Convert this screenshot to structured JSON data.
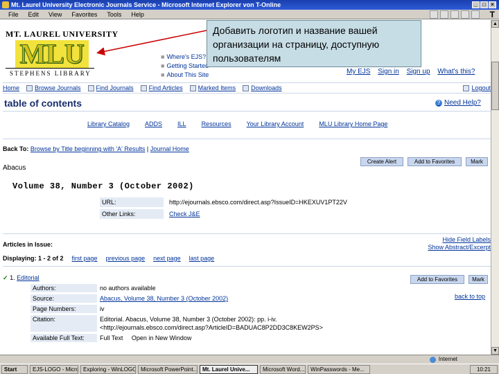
{
  "window": {
    "title": "Mt. Laurel University Electronic Journals Service - Microsoft Internet Explorer von T-Online",
    "menu": [
      "File",
      "Edit",
      "View",
      "Favorites",
      "Tools",
      "Help"
    ],
    "brand": "T"
  },
  "logo": {
    "top": "MT. LAUREL UNIVERSITY",
    "mark": "MLU",
    "bottom": "STEPHENS LIBRARY"
  },
  "top_links": [
    "Where's EJS?",
    "Getting Started",
    "About This Site"
  ],
  "callout": {
    "text": "Добавить логотип и название вашей организации на страницу, доступную пользователям"
  },
  "user_links": [
    "My EJS",
    "Sign in",
    "Sign up",
    "What's this?"
  ],
  "nav": {
    "items": [
      "Home",
      "Browse Journals",
      "Find Journals",
      "Find Articles",
      "Marked Items",
      "Downloads"
    ],
    "logout": "Logout"
  },
  "page": {
    "title": "table of contents",
    "help": "Need Help?"
  },
  "library_links": [
    "Library Catalog",
    "ADDS",
    "ILL",
    "Resources",
    "Your Library Account",
    "MLU Library Home Page"
  ],
  "back": {
    "label": "Back To:",
    "link1": "Browse by Title beginning with 'A' Results",
    "sep": "|",
    "link2": "Journal Home"
  },
  "buttons": {
    "create_alert": "Create Alert",
    "add_favorites": "Add to Favorites",
    "mark": "Mark",
    "item_add_favorites": "Add to Favorites",
    "item_mark": "Mark"
  },
  "journal": {
    "name": "Abacus",
    "volume": "Volume 38, Number 3 (October 2002)",
    "url_label": "URL:",
    "url": "http://ejournals.ebsco.com/direct.asp?IssueID=HKEXUV1PT22V",
    "other_label": "Other Links:",
    "other_value": "Check J&E"
  },
  "articles": {
    "heading": "Articles in Issue:",
    "side_links": [
      "Hide Field Labels",
      "Show Abstract/Excerpt"
    ],
    "displaying": "Displaying: 1 - 2 of 2",
    "paging": [
      "first page",
      "previous page",
      "next page",
      "last page"
    ]
  },
  "item": {
    "check": "✓",
    "number": "1.",
    "title": "Editorial",
    "back_to_top": "back to top",
    "fields": [
      {
        "label": "Authors:",
        "value": "no authors available",
        "link": false
      },
      {
        "label": "Source:",
        "value": "Abacus, Volume 38, Number 3 (October 2002)",
        "link": true
      },
      {
        "label": "Page Numbers:",
        "value": "iv",
        "link": false
      },
      {
        "label": "Citation:",
        "value": "Editorial. Abacus, Volume 38, Number 3 (October 2002): pp. i-iv.",
        "value2": "<http://ejournals.ebsco.com/direct.asp?ArticleID=BADUAC8P2DD3C8KEW2PS>",
        "link": false
      },
      {
        "label": "Available Full Text:",
        "value": "Full Text",
        "value_b": "Open in New Window",
        "link": false
      }
    ]
  },
  "status": {
    "zone": "Internet"
  },
  "taskbar": {
    "start": "Start",
    "items": [
      "EJS-LOGO - Microsoft O...",
      "Exploring - WinLOGO...",
      "Microsoft PowerPoint...",
      "Mt. Laurel Unive...",
      "Microsoft Word...",
      "WinPasswords - Me..."
    ],
    "clock": "10:21"
  },
  "colors": {
    "link": "#003399",
    "callout_bg": "#c7dde6",
    "logo_yellow": "#f2e23c",
    "arrow": "#cc0000"
  }
}
